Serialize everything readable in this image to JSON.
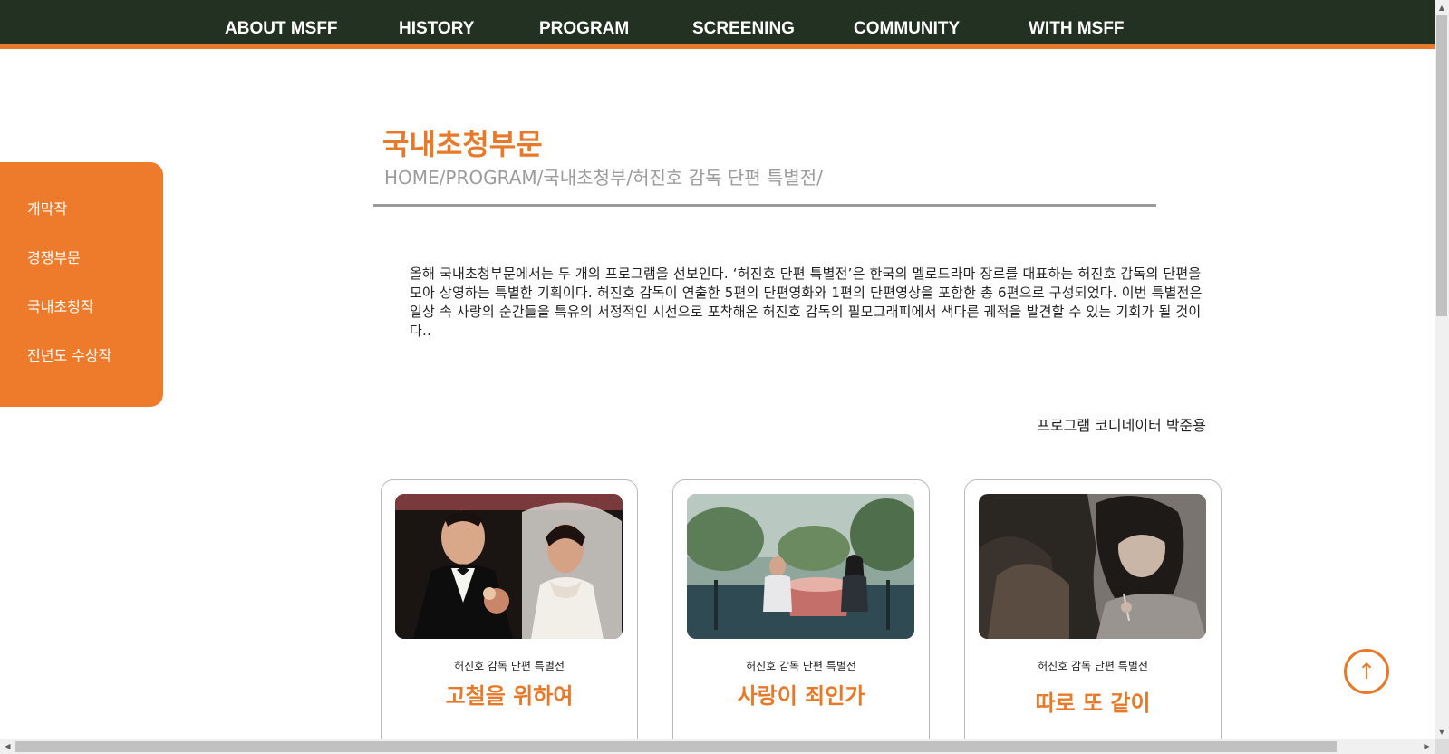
{
  "nav": {
    "items": [
      {
        "label": "ABOUT MSFF"
      },
      {
        "label": "HISTORY"
      },
      {
        "label": "PROGRAM"
      },
      {
        "label": "SCREENING"
      },
      {
        "label": "COMMUNITY"
      },
      {
        "label": "WITH MSFF"
      }
    ]
  },
  "sidemenu": {
    "items": [
      {
        "label": "개막작"
      },
      {
        "label": "경쟁부문"
      },
      {
        "label": "국내초청작"
      },
      {
        "label": "전년도 수상작"
      }
    ]
  },
  "page": {
    "title": "국내초청부문",
    "breadcrumb": "HOME/PROGRAM/국내초청부/허진호 감독 단편 특별전/",
    "intro": "올해 국내초청부문에서는 두 개의 프로그램을 선보인다. ‘허진호 단편 특별전’은 한국의 멜로드라마 장르를 대표하는 허진호 감독의 단편을 모아 상영하는 특별한 기획이다. 허진호 감독이 연출한 5편의 단편영화와 1편의 단편영상을 포함한 총 6편으로 구성되었다. 이번 특별전은 일상 속 사랑의 순간들을 특유의 서정적인 시선으로 포착해온 허진호 감독의 필모그래피에서 색다른 궤적을 발견할 수 있는 기회가 될 것이다..",
    "coordinator": "프로그램 코디네이터 박준용"
  },
  "films": [
    {
      "tag": "허진호 감독 단편 특별전",
      "title": "고철을 위하여",
      "image": "wedding-couple-photo"
    },
    {
      "tag": "허진호 감독 단편 특별전",
      "title": "사랑이 죄인가",
      "image": "cafe-terrace-photo"
    },
    {
      "tag": "허진호 감독 단편 특별전",
      "title": "따로 또 같이",
      "image": "woman-sewing-photo"
    }
  ],
  "scroll_top": {
    "icon": "arrow-up-icon",
    "glyph": "↑"
  },
  "colors": {
    "accent": "#e67a2a",
    "nav_bg": "#233122",
    "side_bg": "#ee7b2c"
  }
}
